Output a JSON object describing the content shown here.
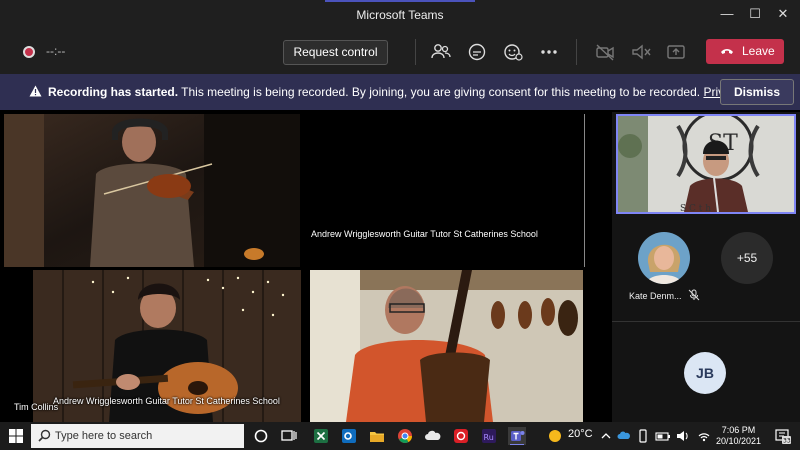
{
  "window": {
    "title": "Microsoft Teams"
  },
  "toolbar": {
    "timer": "--:--",
    "request_control": "Request control",
    "leave": "Leave"
  },
  "banner": {
    "bold": "Recording has started.",
    "message": " This meeting is being recorded. By joining, you are giving consent for this meeting to be recorded. ",
    "link": "Privacy policy",
    "dismiss": "Dismiss"
  },
  "stage": {
    "tiles": [
      {
        "caption": ""
      },
      {
        "caption": "Andrew Wrigglesworth Guitar Tutor St Catherines School"
      },
      {
        "caption": "Andrew Wrigglesworth Guitar Tutor St Catherines School"
      },
      {
        "caption": ""
      }
    ],
    "bottom_left_name": "Tim Collins"
  },
  "sidebar": {
    "participant_name": "Kate Denm...",
    "more_count": "+55",
    "initials": "JB"
  },
  "taskbar": {
    "search_placeholder": "Type here to search",
    "weather": "20°C",
    "time": "7:06 PM",
    "date": "20/10/2021",
    "notifications": "33"
  },
  "colors": {
    "accent": "#4b53bc",
    "leave": "#c4314b",
    "banner": "#2f2f52",
    "active_speaker_border": "#7f85f5"
  }
}
